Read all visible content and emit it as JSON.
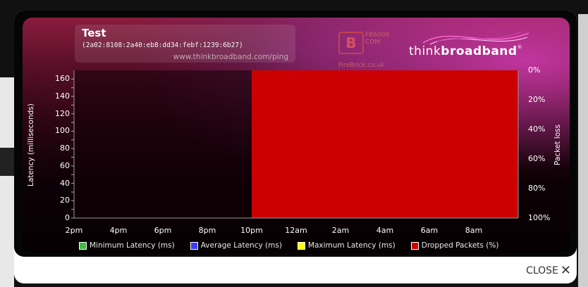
{
  "modal": {
    "title": "Test",
    "subtitle": "(2a02:8108:2a40:eb8:dd34:febf:1239:6b27)",
    "url": "www.thinkbroadband.com/ping",
    "close_label": "CLOSE"
  },
  "logos": {
    "firebrick_mark": "B",
    "firebrick_model": "FB6000\nCOM",
    "firebrick_site": "FireBrick.co.uk",
    "tb_think": "think",
    "tb_broadband": "broadband",
    "tb_reg": "®"
  },
  "colors": {
    "dropped": "#cc0000",
    "min": "#3dbd3d",
    "avg": "#3b3bff",
    "max": "#ffff00"
  },
  "chart_data": {
    "type": "area",
    "title": "Test",
    "ylabel": "Latency (milliseconds)",
    "y2label": "Packet loss",
    "ylim": [
      0,
      170
    ],
    "yticks": [
      0,
      20,
      40,
      60,
      80,
      100,
      120,
      140,
      160
    ],
    "y2ticks": [
      "0%",
      "20%",
      "40%",
      "60%",
      "80%",
      "100%"
    ],
    "xticks": [
      "2pm",
      "4pm",
      "6pm",
      "8pm",
      "10pm",
      "12am",
      "2am",
      "4am",
      "6am",
      "8am"
    ],
    "x_range_hours": [
      14,
      34
    ],
    "series": [
      {
        "name": "Minimum Latency (ms)",
        "color": "#3dbd3d",
        "values": []
      },
      {
        "name": "Average Latency (ms)",
        "color": "#3b3bff",
        "values": []
      },
      {
        "name": "Maximum Latency (ms)",
        "color": "#ffff00",
        "values": []
      },
      {
        "name": "Dropped Packets (%)",
        "color": "#cc0000",
        "start_hour": 22,
        "end_hour": 34,
        "value": 100
      }
    ]
  }
}
